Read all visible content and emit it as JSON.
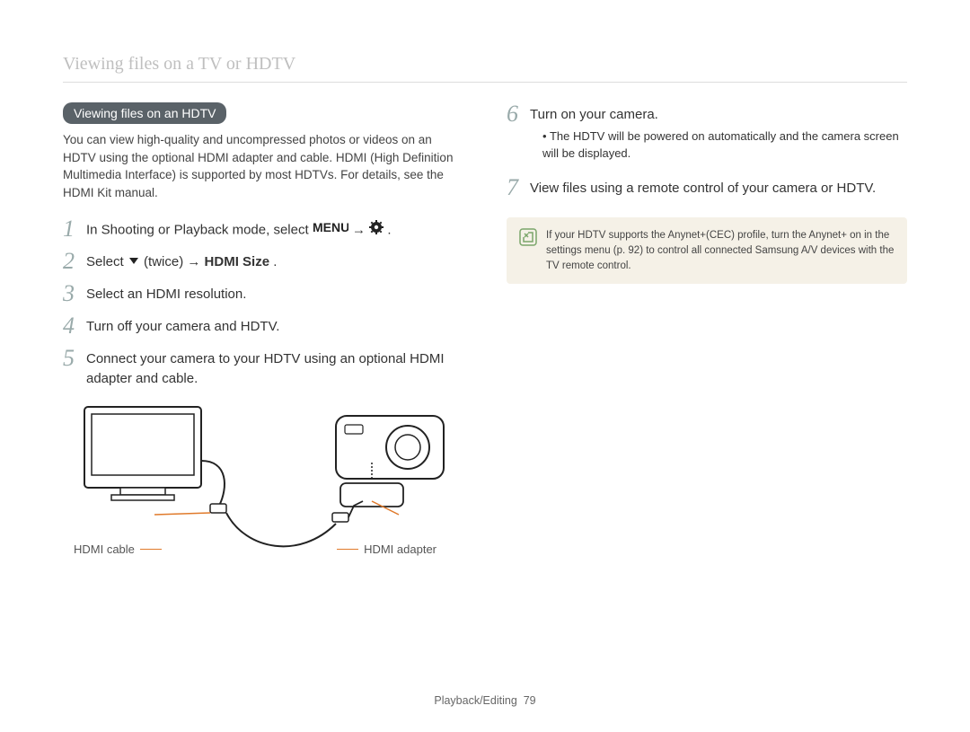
{
  "header": "Viewing files on a TV or HDTV",
  "left": {
    "pill": "Viewing files on an HDTV",
    "intro": "You can view high-quality and uncompressed photos or videos on an HDTV using the optional HDMI adapter and cable. HDMI (High Definition Multimedia Interface) is supported by most HDTVs. For details, see the HDMI Kit manual.",
    "steps": {
      "s1_a": "In Shooting or Playback mode, select ",
      "s1_b": " → ",
      "s1_c": ".",
      "s2_a": "Select ",
      "s2_b": " (twice) → ",
      "s2_c": "HDMI Size",
      "s2_d": ".",
      "s3": "Select an HDMI resolution.",
      "s4": "Turn off your camera and HDTV.",
      "s5": "Connect your camera to your HDTV using an optional HDMI adapter and cable."
    },
    "diagram": {
      "label_cable": "HDMI cable",
      "label_adapter": "HDMI adapter"
    }
  },
  "right": {
    "steps": {
      "s6": "Turn on your camera.",
      "s6_bullet": "The HDTV will be powered on automatically and the camera screen will be displayed.",
      "s7": "View files using a remote control of your camera or HDTV."
    },
    "note": "If your HDTV supports the Anynet+(CEC) profile, turn the Anynet+ on in the settings menu (p. 92) to control all connected Samsung A/V devices with the TV remote control."
  },
  "nums": {
    "n1": "1",
    "n2": "2",
    "n3": "3",
    "n4": "4",
    "n5": "5",
    "n6": "6",
    "n7": "7"
  },
  "footer": {
    "section": "Playback/Editing",
    "page": "79"
  }
}
